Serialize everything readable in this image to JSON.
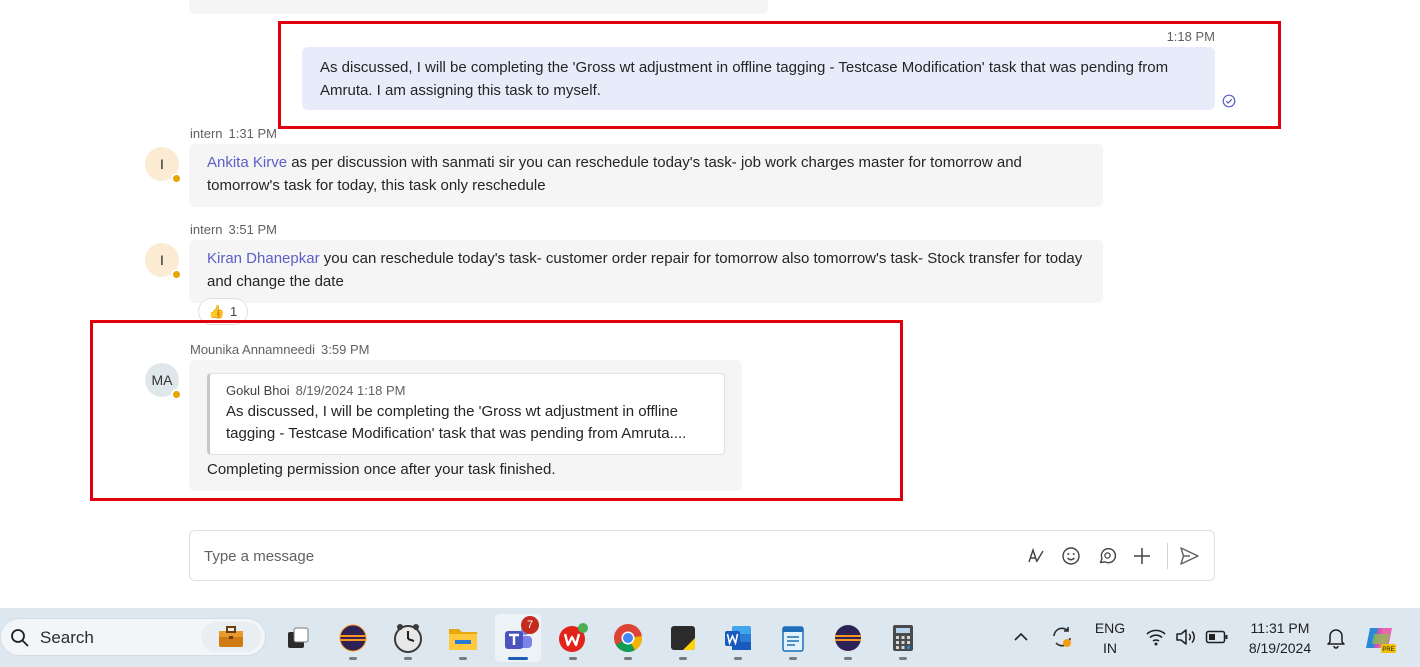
{
  "own_message": {
    "time": "1:18 PM",
    "text": "As discussed, I will be completing the 'Gross wt adjustment in offline tagging - Testcase Modification' task that was pending from Amruta. I am assigning this task to myself."
  },
  "messages": [
    {
      "sender": "intern",
      "time": "1:31 PM",
      "avatar": "I",
      "mention": "Ankita Kirve",
      "text": " as per discussion with sanmati sir you can reschedule today's task- job work charges master for tomorrow and tomorrow's task for today, this task only reschedule"
    },
    {
      "sender": "intern",
      "time": "3:51 PM",
      "avatar": "I",
      "mention": "Kiran Dhanepkar",
      "text": " you can reschedule today's task- customer order repair for tomorrow also tomorrow's task- Stock transfer for today and change the date",
      "reaction": {
        "emoji": "👍",
        "count": "1"
      }
    },
    {
      "sender": "Mounika Annamneedi",
      "time": "3:59 PM",
      "avatar": "MA",
      "quote": {
        "author": "Gokul Bhoi",
        "datetime": "8/19/2024 1:18 PM",
        "text": "As discussed, I will be completing the 'Gross wt adjustment in offline tagging - Testcase Modification' task that was pending from Amruta...."
      },
      "text": "Completing permission once after your task finished."
    }
  ],
  "composer": {
    "placeholder": "Type a message"
  },
  "taskbar": {
    "search_label": "Search",
    "teams_badge": "7",
    "lang_top": "ENG",
    "lang_bottom": "IN",
    "time": "11:31 PM",
    "date": "8/19/2024"
  },
  "colors": {
    "highlight": "#e0000b",
    "own_bubble": "#e8ebfa",
    "mention": "#5b5fc7",
    "status_away": "#eaa300"
  }
}
